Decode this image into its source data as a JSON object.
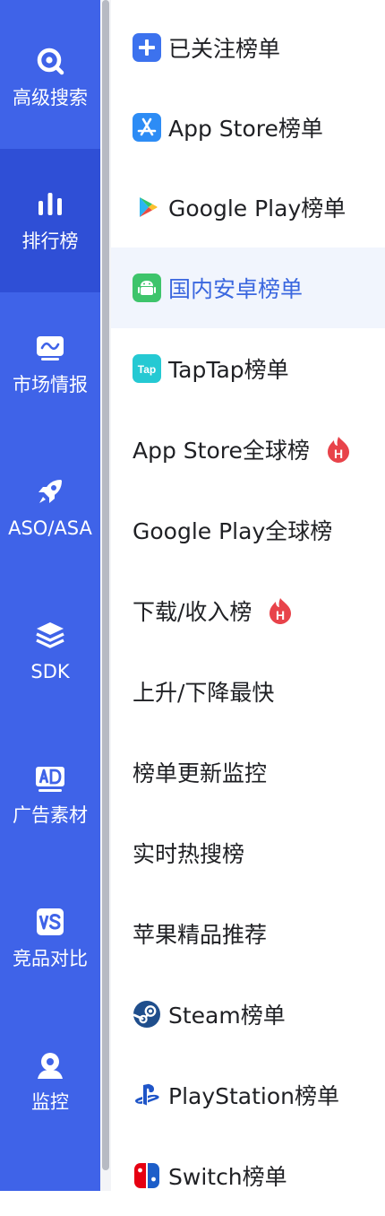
{
  "sidebar": {
    "items": [
      {
        "label": "高级搜索",
        "icon": "search-icon"
      },
      {
        "label": "排行榜",
        "icon": "bar-chart-icon",
        "active": true
      },
      {
        "label": "市场情报",
        "icon": "market-trend-icon"
      },
      {
        "label": "ASO/ASA",
        "icon": "rocket-icon"
      },
      {
        "label": "SDK",
        "icon": "layers-icon"
      },
      {
        "label": "广告素材",
        "icon": "ad-icon"
      },
      {
        "label": "竞品对比",
        "icon": "vs-icon"
      },
      {
        "label": "监控",
        "icon": "monitor-user-icon"
      }
    ]
  },
  "menu": {
    "items": [
      {
        "label": "已关注榜单",
        "icon": "plus-icon"
      },
      {
        "label": "App Store榜单",
        "icon": "app-store-icon"
      },
      {
        "label": "Google Play榜单",
        "icon": "google-play-icon"
      },
      {
        "label": "国内安卓榜单",
        "icon": "android-icon",
        "selected": true
      },
      {
        "label": "TapTap榜单",
        "icon": "taptap-icon",
        "icon_text": "Tap"
      },
      {
        "label": "App Store全球榜",
        "badge": "hot-badge-icon",
        "badge_text": "H"
      },
      {
        "label": "Google Play全球榜"
      },
      {
        "label": "下载/收入榜",
        "badge": "hot-badge-icon",
        "badge_text": "H"
      },
      {
        "label": "上升/下降最快"
      },
      {
        "label": "榜单更新监控"
      },
      {
        "label": "实时热搜榜"
      },
      {
        "label": "苹果精品推荐"
      },
      {
        "label": "Steam榜单",
        "icon": "steam-icon"
      },
      {
        "label": "PlayStation榜单",
        "icon": "playstation-icon"
      },
      {
        "label": "Switch榜单",
        "icon": "switch-icon"
      }
    ]
  },
  "colors": {
    "sidebar_bg": "#3f63e8",
    "sidebar_active": "#2f4fd6",
    "selected_bg": "#f1f5fd",
    "selected_text": "#3a67df",
    "hot_badge": "#e8434a"
  }
}
